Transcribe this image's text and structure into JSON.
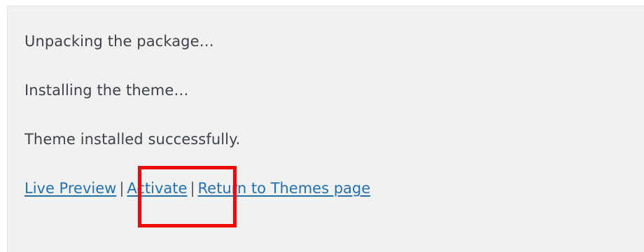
{
  "log": {
    "unpacking": "Unpacking the package…",
    "installing": "Installing the theme…",
    "success": "Theme installed successfully."
  },
  "actions": {
    "live_preview": "Live Preview",
    "separator_1": "|",
    "activate": "Activate",
    "separator_2": "|",
    "return": "Return to Themes page"
  },
  "annotation": {
    "highlight_color": "#ee0a0a",
    "highlighted_item": "Activate"
  },
  "colors": {
    "link": "#2271b1",
    "text": "#3c434a",
    "background": "#f1f1f1"
  }
}
